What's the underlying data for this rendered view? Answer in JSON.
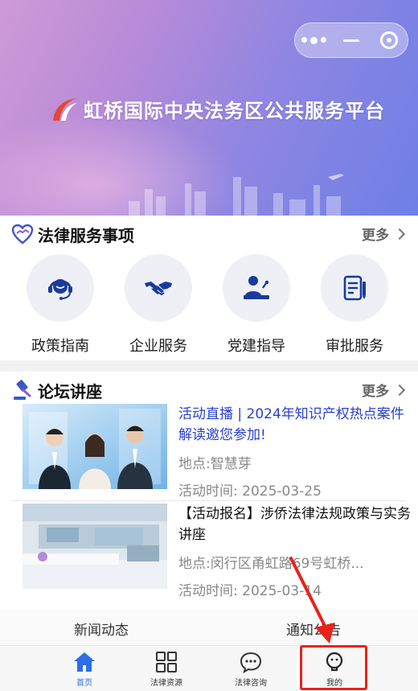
{
  "banner": {
    "title": "虹桥国际中央法务区公共服务平台"
  },
  "capsule": {
    "menu_icon": "more-dots-icon",
    "minimize_icon": "minimize-icon",
    "close_icon": "target-close-icon"
  },
  "legal_services": {
    "title": "法律服务事项",
    "more": "更多",
    "items": [
      {
        "label": "政策指南",
        "icon": "headset-agent-icon"
      },
      {
        "label": "企业服务",
        "icon": "handshake-icon"
      },
      {
        "label": "党建指导",
        "icon": "speaker-podium-icon"
      },
      {
        "label": "审批服务",
        "icon": "document-pen-icon"
      }
    ]
  },
  "forum": {
    "title": "论坛讲座",
    "more": "更多",
    "articles": [
      {
        "title": "活动直播 | 2024年知识产权热点案件解读邀您参加!",
        "location": "地点:智慧芽",
        "time": "活动时间:  2025-03-25"
      },
      {
        "title": "【活动报名】涉侨法律法规政策与实务讲座",
        "location": "地点:闵行区甬虹路69号虹桥...",
        "time": "活动时间:  2025-03-14"
      }
    ]
  },
  "tabs": {
    "news": "新闻动态",
    "notice": "通知公告"
  },
  "bottom_nav": {
    "home": "首页",
    "resources": "法律资源",
    "consult": "法律咨询",
    "mine": "我的"
  },
  "colors": {
    "accent_blue": "#2b6ee8",
    "icon_navy": "#1a3a9c",
    "highlight_red": "#e8221b"
  }
}
